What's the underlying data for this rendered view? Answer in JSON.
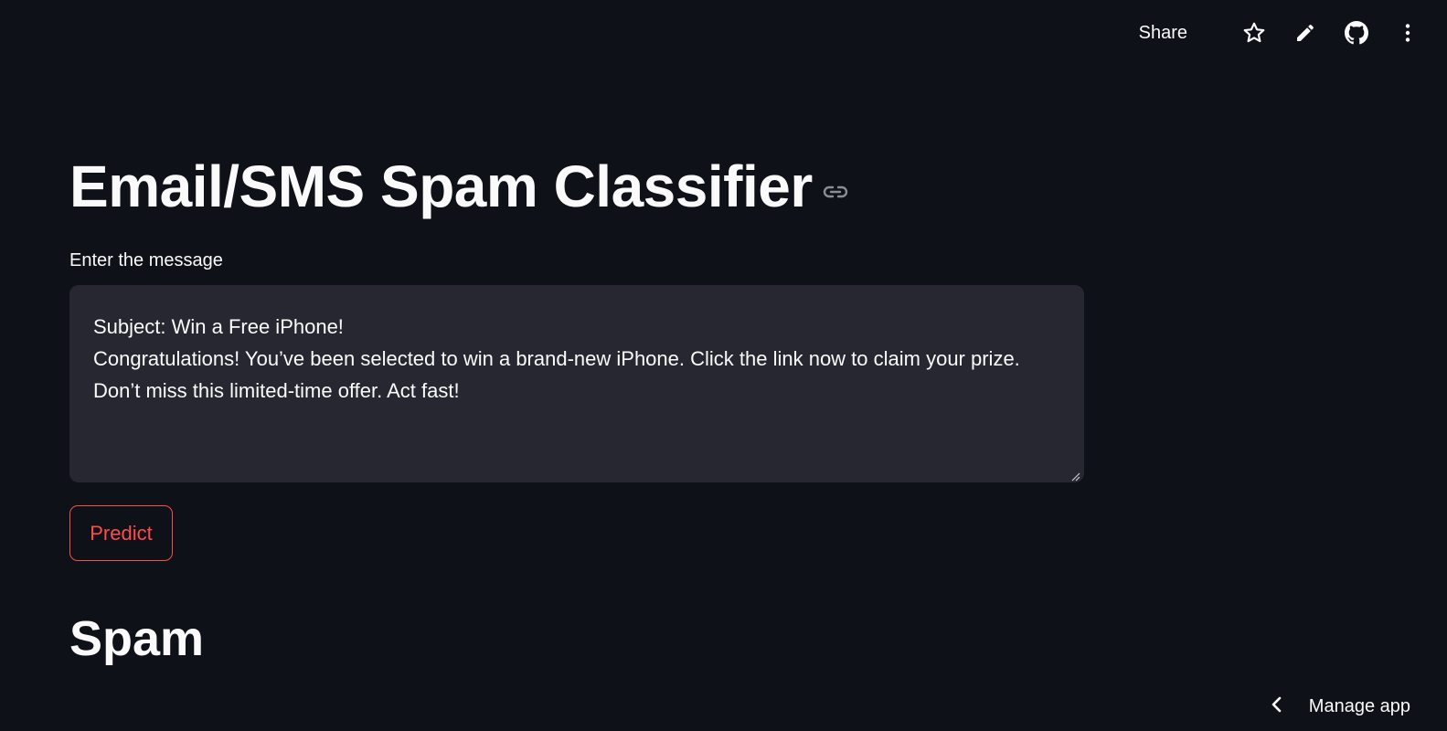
{
  "toolbar": {
    "share_label": "Share",
    "icons": [
      "star-icon",
      "pencil-icon",
      "github-icon",
      "more-vert-icon"
    ]
  },
  "page": {
    "title": "Email/SMS Spam Classifier",
    "anchor_icon": "link-icon"
  },
  "input": {
    "label": "Enter the message",
    "value": "Subject: Win a Free iPhone!\nCongratulations! You’ve been selected to win a brand-new iPhone. Click the link now to claim your prize. Don’t miss this limited-time offer. Act fast!"
  },
  "predict_button": {
    "label": "Predict"
  },
  "result": {
    "text": "Spam"
  },
  "footer": {
    "manage_app_label": "Manage app",
    "icon": "chevron-left-icon"
  },
  "colors": {
    "background": "#0e1117",
    "textarea_bg": "#262730",
    "accent": "#ff4b4b",
    "text": "#fafafa"
  }
}
